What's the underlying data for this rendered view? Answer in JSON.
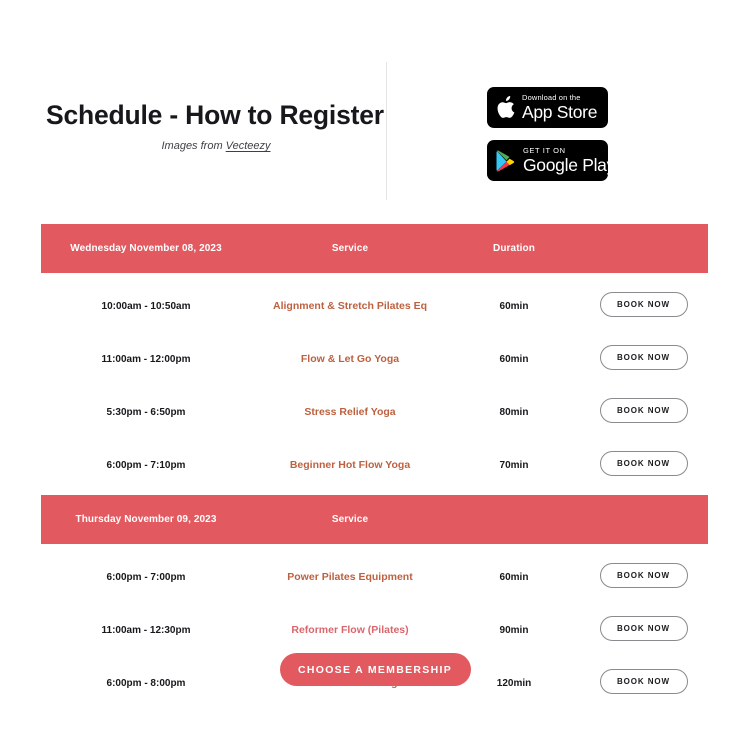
{
  "header": {
    "title": "Schedule - How to Register",
    "subtitle_prefix": "Images from ",
    "subtitle_link": "Vecteezy"
  },
  "store_badges": [
    {
      "name": "app-store",
      "small_text": "Download on the",
      "big_text": "App Store",
      "icon": "apple-icon"
    },
    {
      "name": "google-play",
      "small_text": "GET IT ON",
      "big_text": "Google Play",
      "icon": "google-play-icon"
    }
  ],
  "schedule": {
    "accent_color": "#e25a60",
    "service_color": "#bd6140",
    "days": [
      {
        "date_label": "Wednesday November 08, 2023",
        "service_header": "Service",
        "duration_header": "Duration",
        "rows": [
          {
            "time": "10:00am - 10:50am",
            "service": "Alignment & Stretch Pilates Eq",
            "duration": "60min",
            "action": "BOOK NOW"
          },
          {
            "time": "11:00am - 12:00pm",
            "service": "Flow & Let Go Yoga",
            "duration": "60min",
            "action": "BOOK NOW"
          },
          {
            "time": "5:30pm - 6:50pm",
            "service": "Stress Relief Yoga",
            "duration": "80min",
            "action": "BOOK NOW"
          },
          {
            "time": "6:00pm - 7:10pm",
            "service": "Beginner Hot Flow Yoga",
            "duration": "70min",
            "action": "BOOK NOW"
          }
        ]
      },
      {
        "date_label": "Thursday November 09, 2023",
        "service_header": "Service",
        "duration_header": "",
        "rows": [
          {
            "time": "6:00pm - 7:00pm",
            "service": "Power Pilates Equipment",
            "duration": "60min",
            "action": "BOOK NOW"
          },
          {
            "time": "11:00am - 12:30pm",
            "service": "Reformer Flow (Pilates)",
            "duration": "90min",
            "action": "BOOK NOW"
          },
          {
            "time": "6:00pm - 8:00pm",
            "service": "Yin /Restorative Yoga",
            "duration": "120min",
            "action": "BOOK NOW"
          }
        ]
      }
    ]
  },
  "cta": {
    "label": "CHOOSE A MEMBERSHIP"
  }
}
